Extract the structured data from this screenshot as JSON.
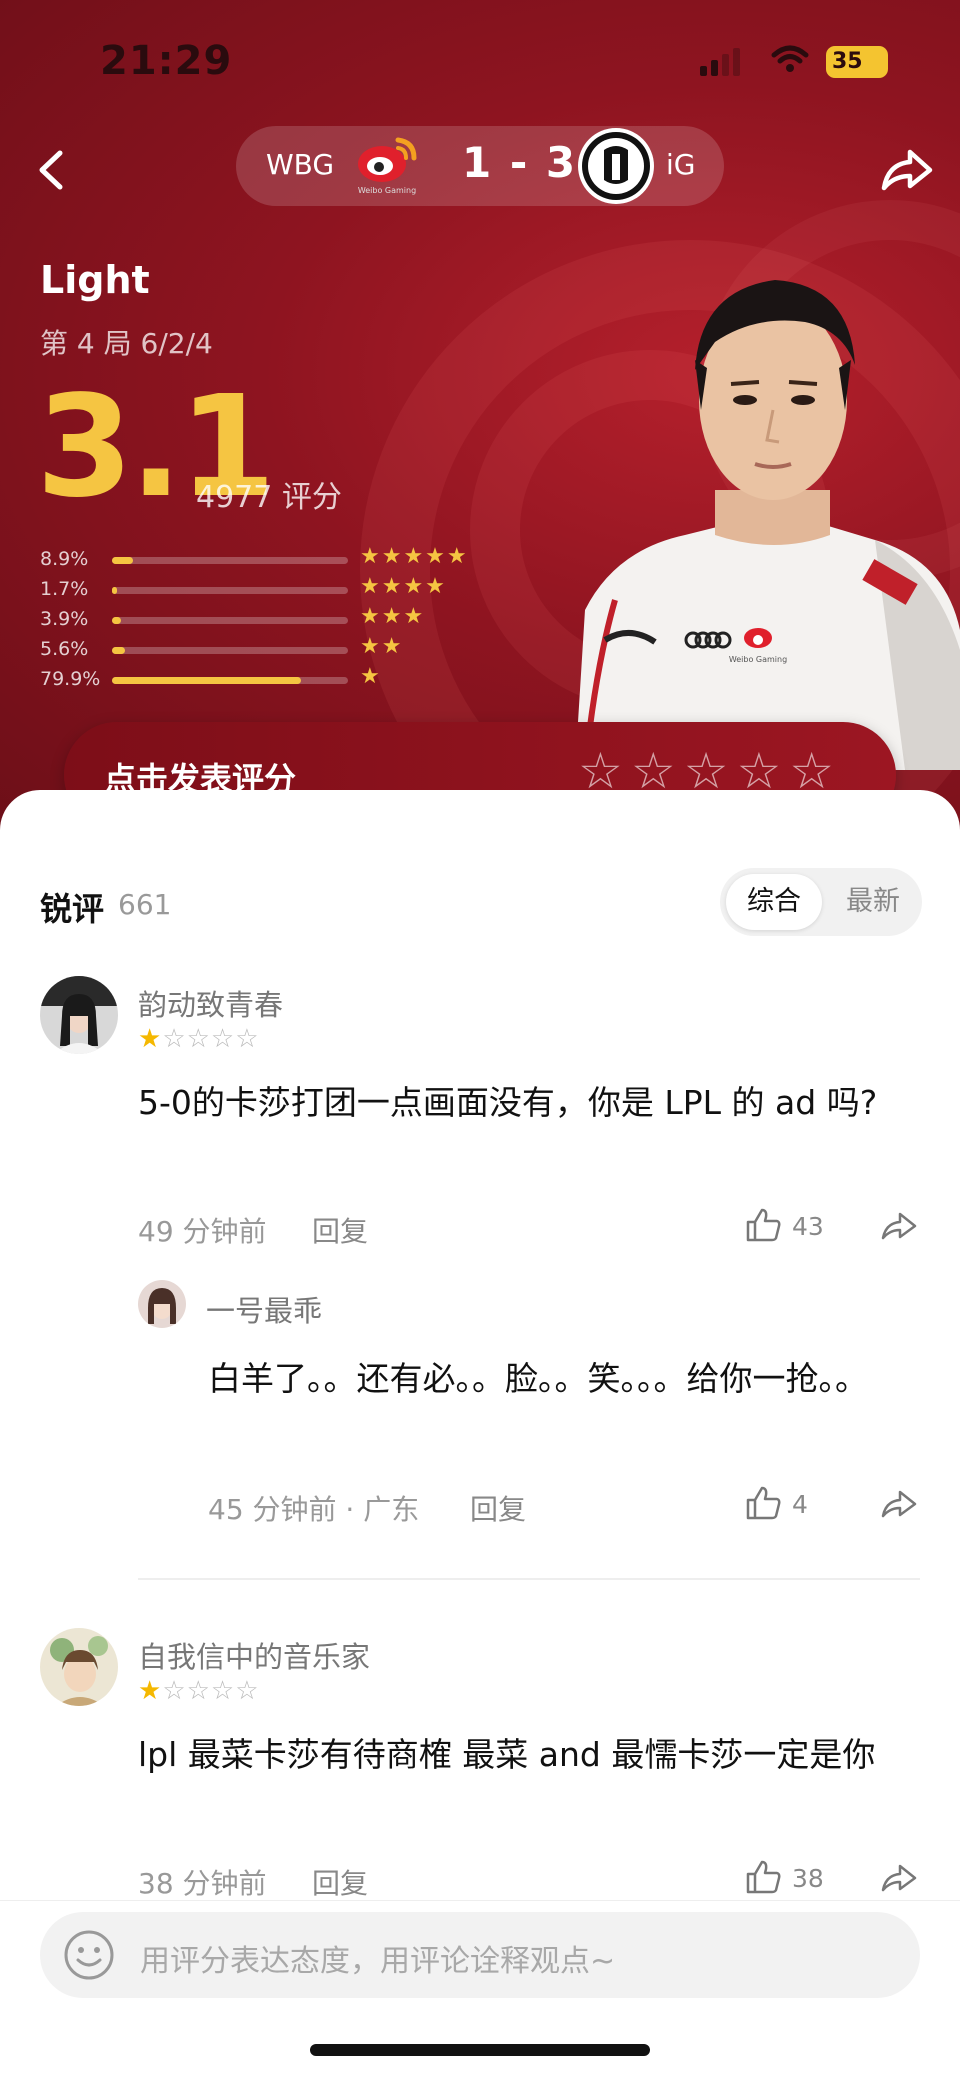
{
  "status": {
    "time": "21:29",
    "battery": "35"
  },
  "header": {
    "team_left": "WBG",
    "team_right": "iG",
    "score": "1 - 3",
    "wbg_logo_caption": "Weibo Gaming"
  },
  "player": {
    "name": "Light",
    "game_info": "第 4 局  6/2/4",
    "score": "3.1",
    "rating_count": "4977 评分",
    "jersey_text": "Weibo Gaming"
  },
  "distribution": [
    {
      "pct": "8.9%",
      "value": 0.089,
      "stars": "★★★★★"
    },
    {
      "pct": "1.7%",
      "value": 0.017,
      "stars": "★★★★"
    },
    {
      "pct": "3.9%",
      "value": 0.039,
      "stars": "★★★"
    },
    {
      "pct": "5.6%",
      "value": 0.056,
      "stars": "★★"
    },
    {
      "pct": "79.9%",
      "value": 0.799,
      "stars": "★"
    }
  ],
  "rate_prompt": {
    "label": "点击发表评分",
    "stars": "☆☆☆☆☆"
  },
  "reviews_section": {
    "title": "锐评",
    "count": "661",
    "sort_options": [
      "综合",
      "最新"
    ]
  },
  "comments": [
    {
      "user": "韵动致青春",
      "stars_on": "★",
      "stars_off": "☆☆☆☆",
      "text": "5-0的卡莎打团一点画面没有，你是 LPL 的 ad 吗?",
      "time": "49 分钟前",
      "reply": "回复",
      "likes": "43"
    },
    {
      "user": "一号最乖",
      "text": "白羊了。。还有必。。脸。。笑。。。给你一抢。。",
      "time": "45 分钟前 · 广东",
      "reply": "回复",
      "likes": "4"
    },
    {
      "user": "自我信中的音乐家",
      "stars_on": "★",
      "stars_off": "☆☆☆☆",
      "text": "lpl 最菜卡莎有待商榷 最菜 and 最懦卡莎一定是你",
      "time": "38 分钟前",
      "reply": "回复",
      "likes": "38"
    }
  ],
  "input": {
    "placeholder": "用评分表达态度，用评论诠释观点~"
  },
  "colors": {
    "accent": "#f5c542",
    "hero": "#8e1420",
    "star": "#f5b800"
  },
  "icons": [
    "back-arrow-icon",
    "share-icon",
    "wbg-logo-icon",
    "ig-logo-icon",
    "like-icon",
    "emoji-icon",
    "wifi-icon",
    "battery-icon",
    "signal-icon"
  ]
}
